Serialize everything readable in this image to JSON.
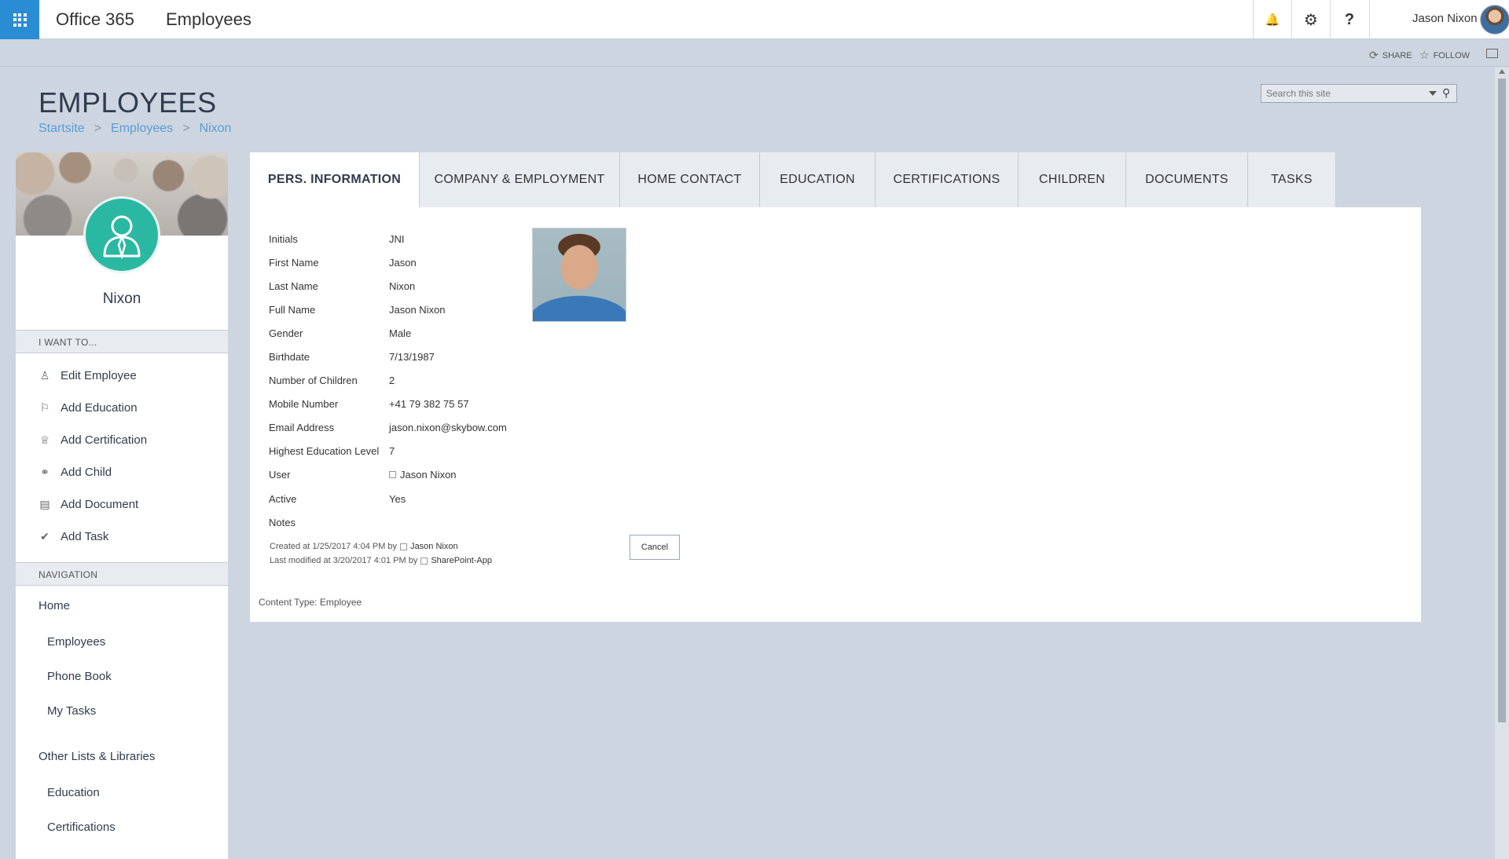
{
  "suitebar": {
    "brand": "Office 365",
    "app_name": "Employees",
    "bell_glyph": "🔔",
    "gear_glyph": "⚙",
    "help_glyph": "?",
    "user_name": "Jason Nixon"
  },
  "ribbon": {
    "share_label": "SHARE",
    "follow_label": "FOLLOW",
    "share_glyph": "⟳",
    "follow_glyph": "☆"
  },
  "page": {
    "title": "EMPLOYEES",
    "breadcrumb": [
      "Startsite",
      "Employees",
      "Nixon"
    ],
    "breadcrumb_separator": ">",
    "search_placeholder": "Search this site",
    "search_glyph": "⚲"
  },
  "profile": {
    "name": "Nixon"
  },
  "actions": {
    "header": "I WANT TO...",
    "items": [
      {
        "label": "Edit Employee",
        "icon": "person-icon",
        "glyph": "♙"
      },
      {
        "label": "Add Education",
        "icon": "education-icon",
        "glyph": "⚐"
      },
      {
        "label": "Add Certification",
        "icon": "certification-icon",
        "glyph": "♕"
      },
      {
        "label": "Add Child",
        "icon": "child-icon",
        "glyph": "⚭"
      },
      {
        "label": "Add Document",
        "icon": "document-icon",
        "glyph": "▤"
      },
      {
        "label": "Add Task",
        "icon": "task-icon",
        "glyph": "✔"
      }
    ]
  },
  "navigation": {
    "header": "NAVIGATION",
    "items": [
      {
        "label": "Home",
        "level": 0
      },
      {
        "label": "Employees",
        "level": 1
      },
      {
        "label": "Phone Book",
        "level": 1
      },
      {
        "label": "My Tasks",
        "level": 1
      },
      {
        "label": "Other Lists & Libraries",
        "level": 0
      },
      {
        "label": "Education",
        "level": 1
      },
      {
        "label": "Certifications",
        "level": 1
      }
    ]
  },
  "tabs": [
    {
      "label": "PERS. INFORMATION",
      "active": true
    },
    {
      "label": "COMPANY & EMPLOYMENT",
      "active": false
    },
    {
      "label": "HOME CONTACT",
      "active": false
    },
    {
      "label": "EDUCATION",
      "active": false
    },
    {
      "label": "CERTIFICATIONS",
      "active": false
    },
    {
      "label": "CHILDREN",
      "active": false
    },
    {
      "label": "DOCUMENTS",
      "active": false
    },
    {
      "label": "TASKS",
      "active": false
    }
  ],
  "fields": [
    {
      "label": "Initials",
      "value": "JNI"
    },
    {
      "label": "First Name",
      "value": "Jason"
    },
    {
      "label": "Last Name",
      "value": "Nixon"
    },
    {
      "label": "Full Name",
      "value": "Jason Nixon"
    },
    {
      "label": "Gender",
      "value": "Male"
    },
    {
      "label": "Birthdate",
      "value": "7/13/1987"
    },
    {
      "label": "Number of Children",
      "value": "2"
    },
    {
      "label": "Mobile Number",
      "value": "+41 79 382 75 57"
    },
    {
      "label": "Email Address",
      "value": "jason.nixon@skybow.com"
    },
    {
      "label": "Highest Education Level",
      "value": "7"
    },
    {
      "label": "User",
      "value": "Jason Nixon",
      "presence": true
    },
    {
      "label": "Active",
      "value": "Yes"
    },
    {
      "label": "Notes",
      "value": ""
    }
  ],
  "meta": {
    "created_prefix": "Created at 1/25/2017 4:04 PM by",
    "created_user": "Jason Nixon",
    "modified_prefix": "Last modified at 3/20/2017 4:01 PM by",
    "modified_user": "SharePoint-App"
  },
  "cancel_label": "Cancel",
  "content_type": "Content Type: Employee",
  "colors": {
    "accent": "#2a8dd4",
    "avatar_teal": "#2bb8a2",
    "page_bg": "#cdd5e0",
    "link": "#5a9bd5"
  }
}
